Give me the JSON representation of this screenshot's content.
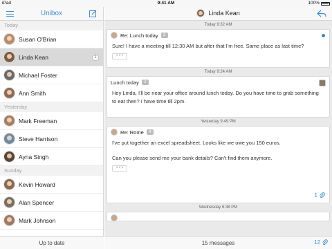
{
  "status_bar": {
    "device": "iPad",
    "time": "9:41 AM",
    "battery": "100%"
  },
  "sidebar": {
    "title": "Unibox",
    "footer": "Up to date",
    "sections": [
      {
        "label": "Today",
        "contacts": [
          {
            "name": "Susan O'Brian",
            "color": "#b98b6a"
          },
          {
            "name": "Linda Kean",
            "color": "#7d5d45",
            "selected": true,
            "count": "1"
          },
          {
            "name": "Michael Foster",
            "color": "#6b6b6b"
          },
          {
            "name": "Ann Smith",
            "color": "#8f6a55"
          }
        ]
      },
      {
        "label": "Yesterday",
        "contacts": [
          {
            "name": "Mark Freeman",
            "color": "#a77e62"
          },
          {
            "name": "Steve Harrison",
            "color": "#6e8aa3"
          },
          {
            "name": "Ayna Singh",
            "color": "#5a4437"
          }
        ]
      },
      {
        "label": "Sunday",
        "contacts": [
          {
            "name": "Kevin Howard",
            "color": "#8b6b4f"
          },
          {
            "name": "Alan Spencer",
            "color": "#7a7060"
          },
          {
            "name": "Mark Johnson",
            "color": "#9d7a63"
          }
        ]
      }
    ]
  },
  "main": {
    "header_name": "Linda Kean",
    "footer_count": "15 messages",
    "footer_attachments": "12",
    "messages": [
      {
        "date": "Today 9:32 AM",
        "subject": "Re: Lunch today",
        "thread_count": "2",
        "body": [
          "Sure! I have a meeting till 12:30 AM but after that I'm free. Same place as last time?"
        ],
        "unread": true
      },
      {
        "date": "Today 9:24 AM",
        "subject": "Lunch today",
        "thread_count": "2",
        "body": [
          "Hey Linda, I'll be near your office around lunch today. Do you have time to grab something to eat then? I have time till 2pm."
        ]
      },
      {
        "date": "Yesterday 9:49 PM",
        "subject": "Re: Rome",
        "thread_count": "4",
        "body": [
          "I've put together an excel spreadsheet. Looks like we owe you 150 euros.",
          "Can you please send me your bank details? Can't find them anymore."
        ],
        "attachments": "1"
      },
      {
        "date": "Wednesday 6:38 PM"
      }
    ]
  }
}
